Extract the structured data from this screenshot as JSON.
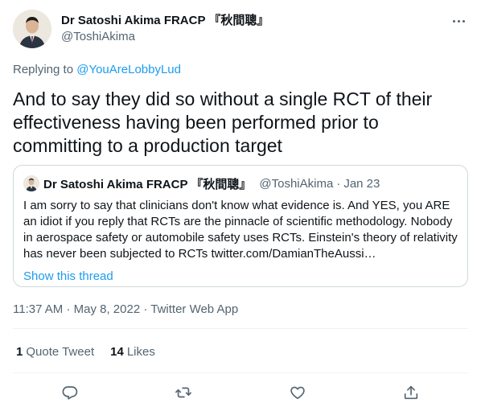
{
  "author": {
    "display_name": "Dr Satoshi Akima FRACP 『秋間聰』",
    "handle": "@ToshiAkima",
    "avatar_icon": "person-photo-avatar"
  },
  "reply": {
    "prefix": "Replying to ",
    "target": "@YouAreLobbyLud"
  },
  "tweet": {
    "text": "And to say they did so without a single RCT of their effectiveness having been performed prior to committing to a production target"
  },
  "quoted": {
    "display_name": "Dr Satoshi Akima FRACP 『秋間聰』",
    "handle": "@ToshiAkima",
    "separator": "·",
    "date": "Jan 23",
    "text": "I am sorry to say that clinicians don't know what evidence is. And YES, you ARE an idiot if you reply that RCTs are the pinnacle of scientific methodology. Nobody in aerospace safety or automobile safety uses RCTs. Einstein's theory of relativity has never been subjected to RCTs twitter.com/DamianTheAussi…",
    "show_thread": "Show this thread"
  },
  "meta": {
    "time": "11:37 AM",
    "sep1": " · ",
    "date": "May 8, 2022",
    "sep2": " · ",
    "app": "Twitter Web App"
  },
  "stats": {
    "quote_count": "1",
    "quote_label": "Quote Tweet",
    "like_count": "14",
    "like_label": "Likes"
  },
  "actions": [
    "reply-icon",
    "retweet-icon",
    "like-icon",
    "share-icon"
  ],
  "colors": {
    "text": "#0f1419",
    "secondary": "#536471",
    "link": "#1d9bf0",
    "border": "#cfd9de"
  }
}
